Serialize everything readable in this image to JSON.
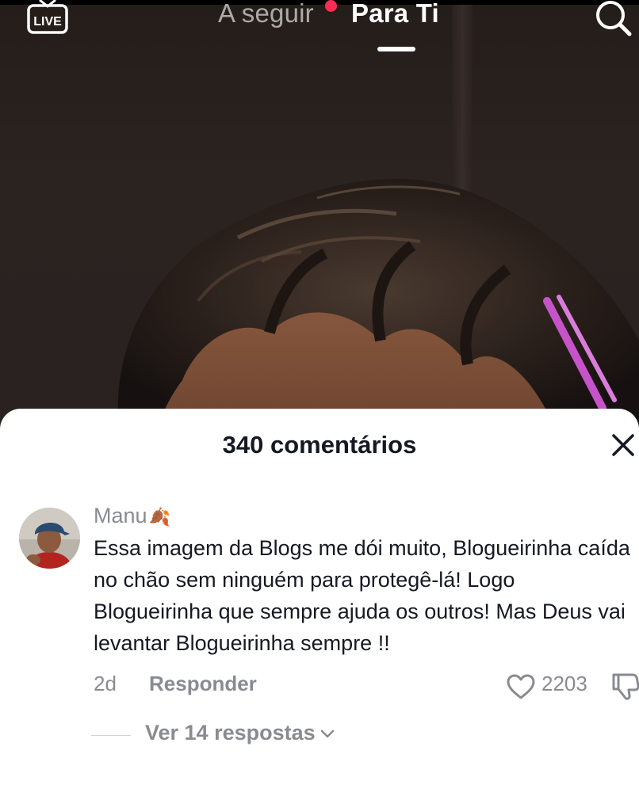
{
  "nav": {
    "live_label": "LIVE",
    "tabs": [
      {
        "label": "A seguir",
        "active": false,
        "has_notification": true
      },
      {
        "label": "Para Ti",
        "active": true
      }
    ]
  },
  "comments_panel": {
    "title": "340 comentários",
    "comments": [
      {
        "username": "Manu",
        "username_emoji": "🍂",
        "text_lines": [
          "Essa imagem da Blogs me dói muito, Blogueirinha caída",
          "no chão sem ninguém para protegê-lá! Logo",
          "Blogueirinha que sempre ajuda os outros! Mas Deus vai",
          "levantar Blogueirinha sempre !!"
        ],
        "age": "2d",
        "reply_label": "Responder",
        "like_count": "2203",
        "view_replies_label": "Ver 14 respostas"
      }
    ]
  },
  "colors": {
    "accent": "#fe2c55",
    "text_primary": "#161823",
    "text_secondary": "#8a8b91"
  }
}
